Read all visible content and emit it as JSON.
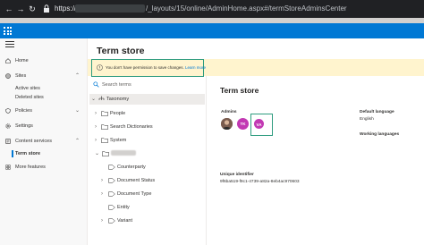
{
  "browser": {
    "url_scheme": "https://",
    "url_path": "/_layouts/15/online/AdminHome.aspx#/termStoreAdminsCenter"
  },
  "left_nav": {
    "items": [
      {
        "label": "Home",
        "icon": "home-icon"
      },
      {
        "label": "Sites",
        "icon": "globe-icon",
        "children": [
          "Active sites",
          "Deleted sites"
        ]
      },
      {
        "label": "Policies",
        "icon": "policy-icon"
      },
      {
        "label": "Settings",
        "icon": "gear-icon"
      },
      {
        "label": "Content services",
        "icon": "content-services-icon",
        "children": [
          "Term store"
        ],
        "active_child": "Term store"
      },
      {
        "label": "More features",
        "icon": "more-features-icon"
      }
    ]
  },
  "page": {
    "title": "Term store"
  },
  "banner": {
    "message": "You don't have permission to save changes.",
    "link": "Learn more"
  },
  "tree": {
    "search_placeholder": "Search terms",
    "root": "Taxonomy",
    "groups": [
      "People",
      "Search Dictionaries",
      "System"
    ],
    "term_sets": [
      "Counterparty",
      "Document Status",
      "Document Type",
      "Entity",
      "Variant"
    ]
  },
  "detail": {
    "title": "Term store",
    "admins_label": "Admins",
    "admins": [
      {
        "initials": "",
        "kind": "photo"
      },
      {
        "initials": "TK",
        "color": "#c239b3"
      },
      {
        "initials": "VA",
        "color": "#c239b3"
      }
    ],
    "default_language_label": "Default language",
    "default_language": "English",
    "working_languages_label": "Working languages",
    "unique_identifier_label": "Unique identifier",
    "unique_identifier": "9f6ba519-f9c1-4739-a82a-8eb4ac970603"
  },
  "colors": {
    "suite_bar": "#0078d4",
    "banner_bg": "#fff4ce",
    "highlight_box": "#2e9c7f",
    "avatar": "#c239b3"
  }
}
